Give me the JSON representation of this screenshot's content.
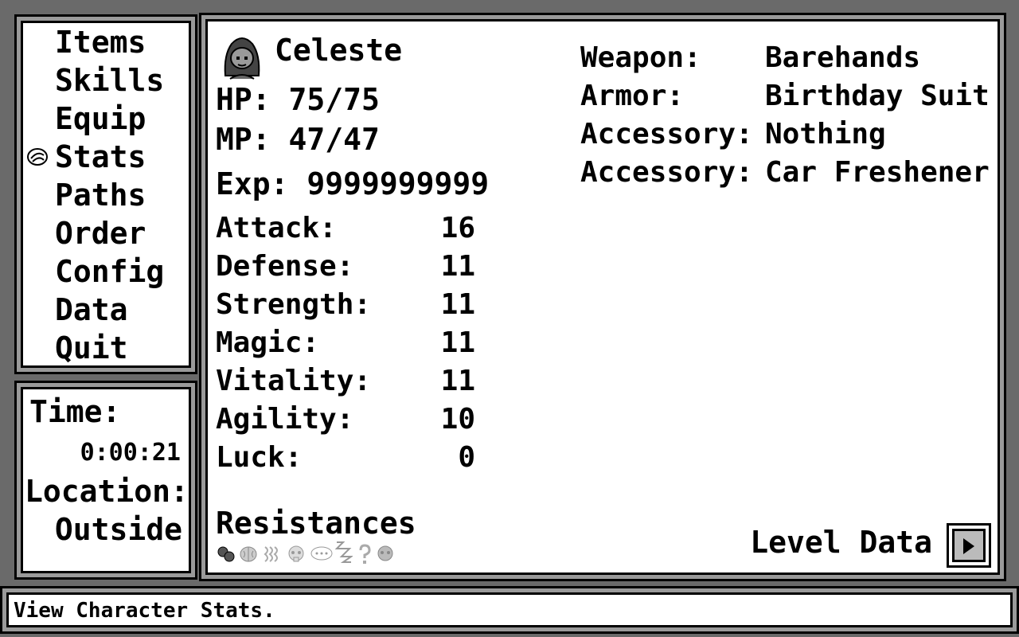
{
  "menu": {
    "items": [
      {
        "label": "Items"
      },
      {
        "label": "Skills"
      },
      {
        "label": "Equip"
      },
      {
        "label": "Stats"
      },
      {
        "label": "Paths"
      },
      {
        "label": "Order"
      },
      {
        "label": "Config"
      },
      {
        "label": "Data"
      },
      {
        "label": "Quit"
      }
    ],
    "selected": "Stats"
  },
  "info": {
    "time_label": "Time:",
    "time_value": "0:00:21",
    "location_label": "Location:",
    "location_value": "Outside"
  },
  "character": {
    "name": "Celeste",
    "hp": "HP: 75/75",
    "mp": "MP: 47/47",
    "exp": "Exp: 9999999999",
    "stats": [
      {
        "label": "Attack:",
        "value": "16"
      },
      {
        "label": "Defense:",
        "value": "11"
      },
      {
        "label": "Strength:",
        "value": "11"
      },
      {
        "label": "Magic:",
        "value": "11"
      },
      {
        "label": "Vitality:",
        "value": "11"
      },
      {
        "label": "Agility:",
        "value": "10"
      },
      {
        "label": "Luck:",
        "value": "0"
      }
    ],
    "resistances_label": "Resistances",
    "resistance_icons": [
      "poison-icon",
      "brain-icon",
      "wave-icon",
      "skull-icon",
      "speech-icon",
      "sleep-icon",
      "question-icon",
      "skull-icon"
    ]
  },
  "equipment": [
    {
      "label": "Weapon:",
      "value": "Barehands"
    },
    {
      "label": "Armor:",
      "value": "Birthday Suit"
    },
    {
      "label": "Accessory:",
      "value": "Nothing"
    },
    {
      "label": "Accessory:",
      "value": "Car Freshener"
    }
  ],
  "level_data_label": "Level Data",
  "help_text": "View Character Stats.",
  "colors": {
    "background": "#6a6a6a",
    "window": "#ffffff",
    "border": "#000000",
    "border_mid": "#9a9a9a"
  }
}
